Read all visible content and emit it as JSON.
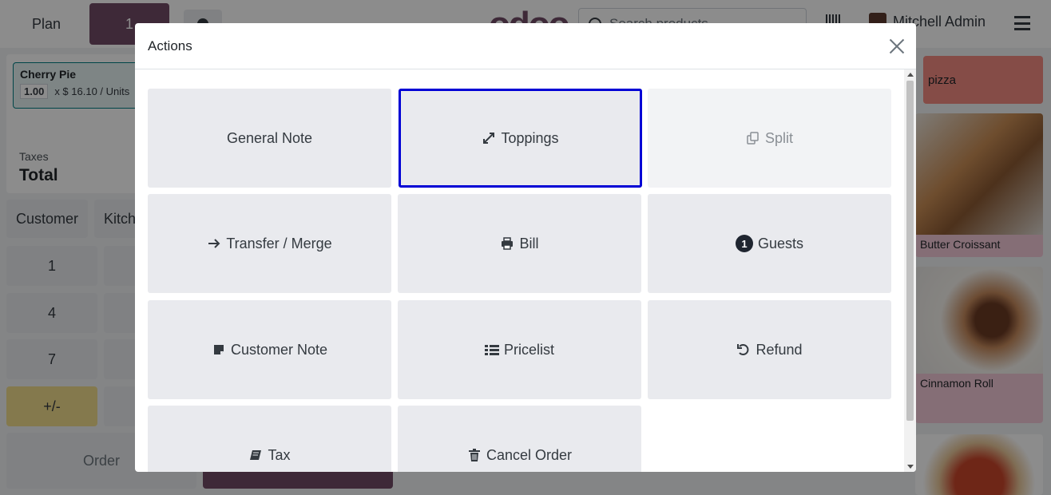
{
  "topbar": {
    "plan_label": "Plan",
    "order_tab_label": "1",
    "logo_text": "odoo",
    "search_placeholder": "Search products...",
    "user_name": "Mitchell Admin"
  },
  "order": {
    "line_product": "Cherry Pie",
    "line_qty": "1.00",
    "line_price": "x $ 16.10 / Units",
    "taxes_label": "Taxes",
    "total_label": "Total"
  },
  "controls": {
    "customer_label": "Customer",
    "kitchen_label": "Kitch",
    "order_label": "Order",
    "numpad": [
      "1",
      "4",
      "7",
      "+/-"
    ]
  },
  "products": {
    "category": "pizza",
    "items": [
      "Butter Croissant",
      "Cinnamon Roll"
    ]
  },
  "modal": {
    "title": "Actions",
    "actions": [
      {
        "label": "General Note",
        "icon": ""
      },
      {
        "label": "Toppings",
        "icon": "expand-icon"
      },
      {
        "label": "Split",
        "icon": "copy-icon"
      },
      {
        "label": "Transfer / Merge",
        "icon": "arrow-right-icon"
      },
      {
        "label": "Bill",
        "icon": "print-icon"
      },
      {
        "label": "Guests",
        "icon": "guests-count-badge",
        "badge": "1"
      },
      {
        "label": "Customer Note",
        "icon": "sticky-note-icon"
      },
      {
        "label": "Pricelist",
        "icon": "list-icon"
      },
      {
        "label": "Refund",
        "icon": "undo-icon"
      },
      {
        "label": "Tax",
        "icon": "book-icon"
      },
      {
        "label": "Cancel Order",
        "icon": "trash-icon"
      }
    ]
  },
  "colors": {
    "selected_border": "#0000d5",
    "tile_bg": "#e9eaee",
    "brand": "#714b67"
  }
}
